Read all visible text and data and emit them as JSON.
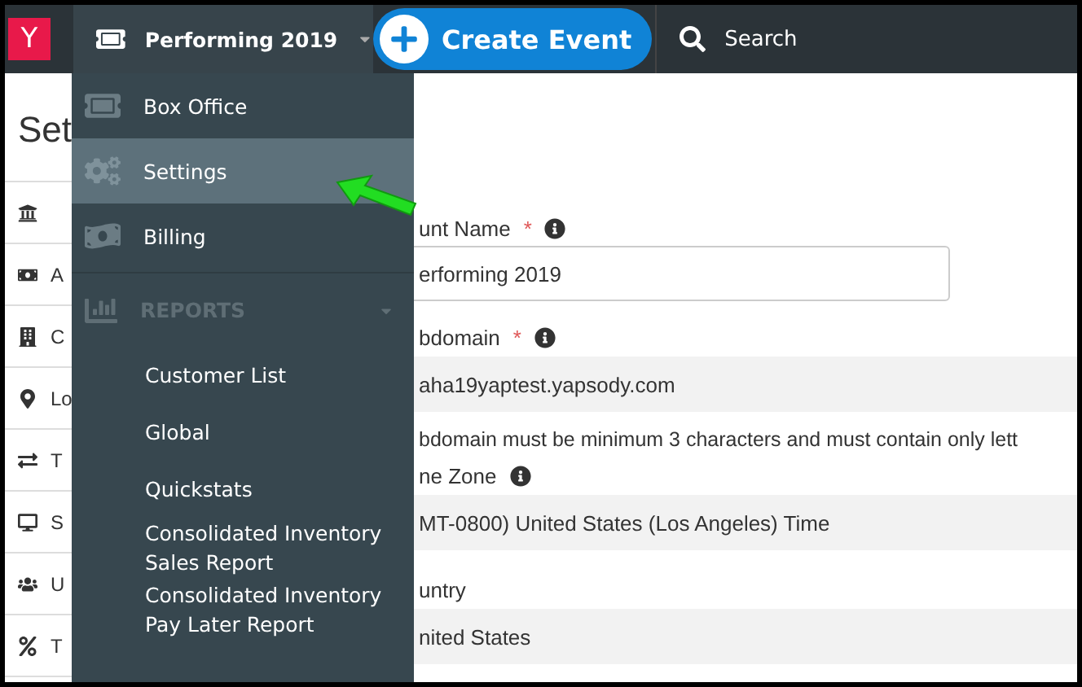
{
  "top_bar": {
    "logo": "Y",
    "event_menu": "Performing 2019",
    "create_button": "Create Event",
    "search": {
      "placeholder": "Search"
    }
  },
  "page": {
    "heading": "Set"
  },
  "settings_nav": [
    {
      "kind": "icon_only"
    },
    {
      "kind": "labeled",
      "label": "A"
    },
    {
      "kind": "labeled",
      "label": "C"
    },
    {
      "kind": "labeled",
      "label": "Lo"
    },
    {
      "kind": "labeled",
      "label": "T"
    },
    {
      "kind": "labeled",
      "label": "S"
    },
    {
      "kind": "labeled",
      "label": "U"
    },
    {
      "kind": "labeled",
      "label": "T"
    }
  ],
  "dropdown": [
    {
      "kind": "item",
      "label": "Box Office",
      "selected": false
    },
    {
      "kind": "item",
      "label": "Settings",
      "selected": true
    },
    {
      "kind": "item",
      "label": "Billing",
      "selected": false
    },
    {
      "kind": "section",
      "label": "REPORTS"
    },
    {
      "kind": "report",
      "label": "Customer List"
    },
    {
      "kind": "report",
      "label": "Global"
    },
    {
      "kind": "report",
      "label": "Quickstats"
    },
    {
      "kind": "report",
      "label": "Consolidated Inventory Sales Report"
    },
    {
      "kind": "report",
      "label": "Consolidated Inventory Pay Later Report"
    }
  ],
  "form": [
    {
      "kind": "input",
      "label": "unt Name",
      "required_mark": "*",
      "info": true,
      "value": "erforming 2019"
    },
    {
      "kind": "readonly",
      "label": "bdomain",
      "required_mark": "*",
      "info": true,
      "value": "aha19yaptest.yapsody.com",
      "help": "bdomain must be minimum 3 characters and must contain only lett"
    },
    {
      "kind": "readonly",
      "label": "ne Zone",
      "info": true,
      "value": "MT-0800) United States (Los Angeles) Time"
    },
    {
      "kind": "readonly",
      "label": "untry",
      "info": false,
      "value": "nited States"
    }
  ]
}
